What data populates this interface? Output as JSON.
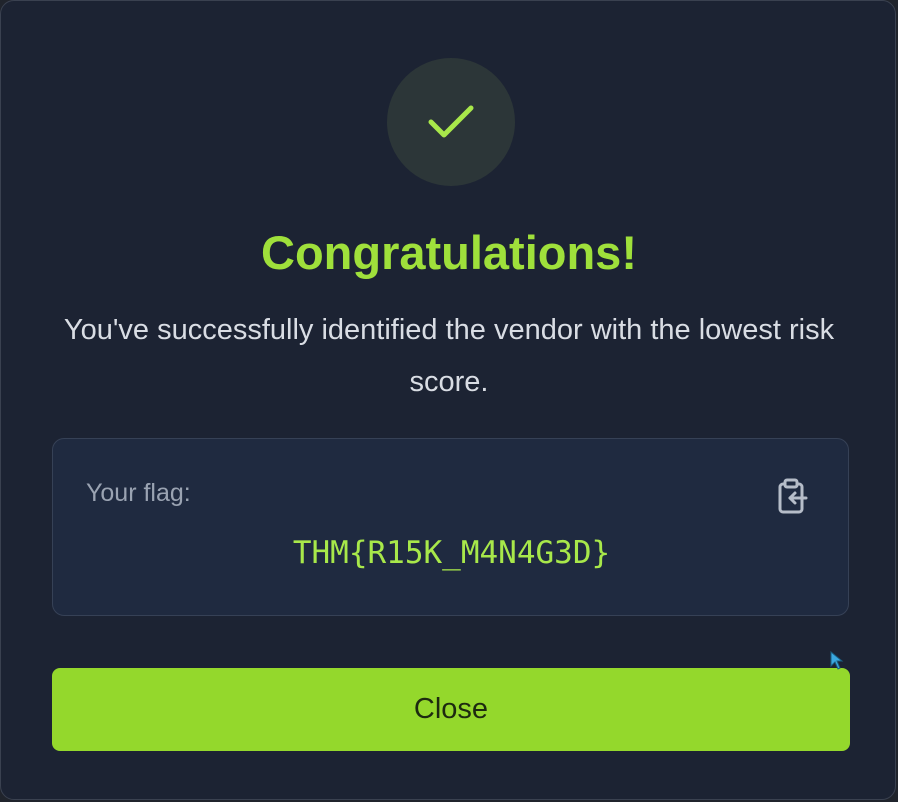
{
  "dialog": {
    "title": "Congratulations!",
    "message": "You've successfully identified the vendor with the lowest risk score.",
    "icon": "checkmark-icon"
  },
  "flag": {
    "label": "Your flag:",
    "value": "THM{R15K_M4N4G3D}",
    "copy_icon": "clipboard-copy-icon"
  },
  "actions": {
    "close_label": "Close"
  },
  "colors": {
    "accent": "#94d82c",
    "title": "#9fe03b",
    "background": "#1c2333",
    "flag_box": "#1f2a40"
  }
}
